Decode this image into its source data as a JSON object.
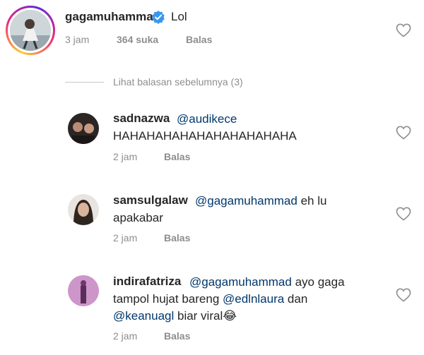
{
  "top_comment": {
    "username": "gagamuhammad",
    "verified": true,
    "text": "Lol",
    "time": "3 jam",
    "likes": "364 suka",
    "reply_label": "Balas"
  },
  "view_previous_label": "Lihat balasan sebelumnya (3)",
  "replies": [
    {
      "username": "sadnazwa",
      "mention": "@audikece",
      "line1_rest": "",
      "line2": "HAHAHAHAHAHAHAHAHAHAHA",
      "time": "2 jam",
      "reply_label": "Balas"
    },
    {
      "username": "samsulgalaw",
      "mention": "@gagamuhammad",
      "line1_rest": " eh lu",
      "line2": "apakabar",
      "time": "2 jam",
      "reply_label": "Balas"
    },
    {
      "username": "indirafatriza",
      "mention": "@gagamuhammad",
      "line1_rest": " ayo gaga",
      "line2_text": "tampol hujat bareng ",
      "line2_mention": "@edlnlaura",
      "line2_rest": " dan",
      "line3_mention": "@keanuagl",
      "line3_rest": " biar viral",
      "line3_emoji": "😂",
      "time": "2 jam",
      "reply_label": "Balas"
    }
  ],
  "colors": {
    "text": "#262626",
    "mention": "#00376b",
    "meta": "#8e8e8e",
    "verified": "#3897f0"
  }
}
